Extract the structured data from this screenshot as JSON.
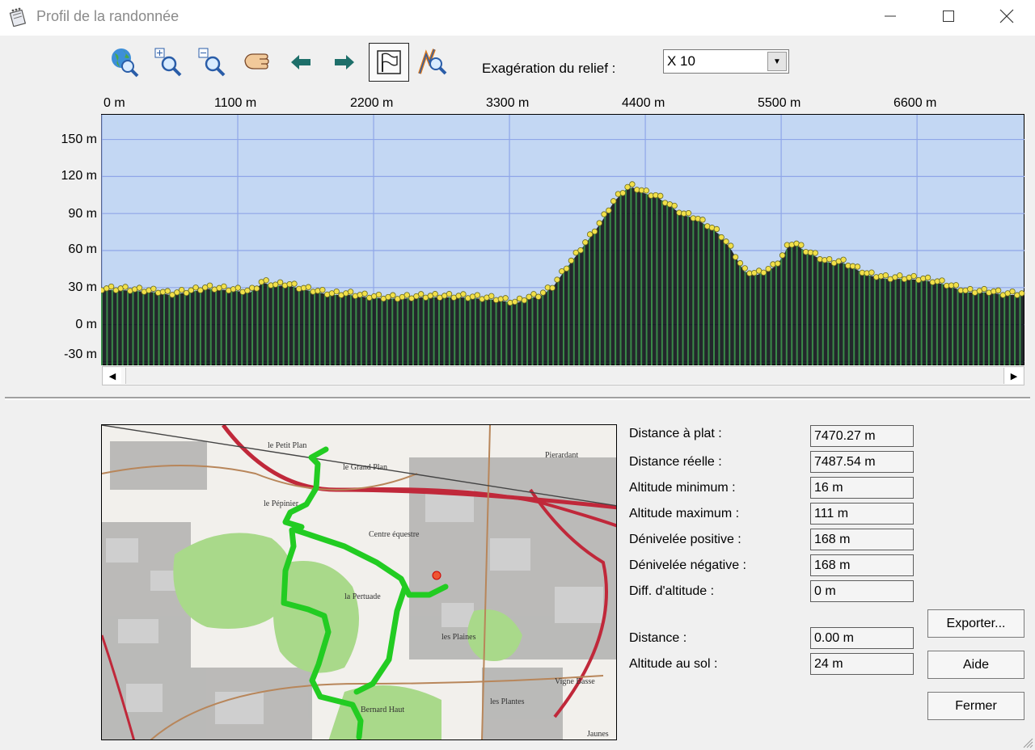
{
  "window": {
    "title": "Profil de la randonnée",
    "minimize_icon": "minimize-icon",
    "maximize_icon": "maximize-icon",
    "close_icon": "close-icon"
  },
  "toolbar": {
    "buttons": [
      {
        "name": "zoom-full-button",
        "icon": "globe-magnifier-icon"
      },
      {
        "name": "zoom-in-button",
        "icon": "zoom-in-icon"
      },
      {
        "name": "zoom-out-button",
        "icon": "zoom-out-icon"
      },
      {
        "name": "pan-button",
        "icon": "hand-icon"
      },
      {
        "name": "previous-button",
        "icon": "arrow-left-icon"
      },
      {
        "name": "next-button",
        "icon": "arrow-right-icon"
      },
      {
        "name": "flag-button",
        "icon": "flag-icon",
        "active": true
      },
      {
        "name": "zoom-profile-button",
        "icon": "profile-zoom-icon"
      }
    ],
    "relief_label": "Exagération du relief :",
    "relief_value": "X 10"
  },
  "chart_data": {
    "type": "area",
    "x_ticks": [
      "0 m",
      "1100 m",
      "2200 m",
      "3300 m",
      "4400 m",
      "5500 m",
      "6600 m"
    ],
    "y_ticks": [
      "150 m",
      "120 m",
      "90 m",
      "60 m",
      "30 m",
      "0 m",
      "-30 m"
    ],
    "x_range": [
      0,
      7470
    ],
    "y_range": [
      -33,
      170
    ],
    "profile": {
      "x": [
        0,
        150,
        300,
        450,
        550,
        700,
        850,
        1000,
        1100,
        1200,
        1250,
        1300,
        1400,
        1500,
        1600,
        1700,
        1850,
        2000,
        2150,
        2300,
        2450,
        2600,
        2750,
        2900,
        3050,
        3200,
        3300,
        3350,
        3450,
        3550,
        3650,
        3750,
        3850,
        3950,
        4050,
        4150,
        4250,
        4300,
        4400,
        4500,
        4600,
        4700,
        4800,
        4900,
        5000,
        5100,
        5200,
        5300,
        5400,
        5450,
        5500,
        5550,
        5600,
        5700,
        5800,
        5850,
        5900,
        6000,
        6100,
        6200,
        6350,
        6500,
        6650,
        6800,
        6950,
        7000,
        7100,
        7200,
        7300,
        7470
      ],
      "y": [
        28,
        28,
        27,
        26,
        24,
        26,
        29,
        28,
        27,
        26,
        29,
        34,
        31,
        32,
        29,
        27,
        24,
        24,
        22,
        21,
        21,
        22,
        22,
        22,
        21,
        20,
        18,
        17,
        21,
        23,
        30,
        44,
        57,
        70,
        84,
        100,
        110,
        111,
        106,
        103,
        96,
        89,
        86,
        80,
        73,
        60,
        43,
        40,
        44,
        47,
        53,
        62,
        66,
        59,
        54,
        51,
        50,
        50,
        45,
        40,
        37,
        37,
        36,
        33,
        28,
        26,
        26,
        26,
        24,
        24
      ]
    },
    "grid": true,
    "background": "#c3d7f3",
    "fill_color": "#000000",
    "bar_color": "#3a8a48",
    "marker_color": "#f2e04a"
  },
  "stats": [
    {
      "label": "Distance à plat :",
      "value": "7470.27 m"
    },
    {
      "label": "Distance réelle :",
      "value": "7487.54 m"
    },
    {
      "label": "Altitude minimum :",
      "value": "16 m"
    },
    {
      "label": "Altitude maximum :",
      "value": "111 m"
    },
    {
      "label": "Dénivelée positive :",
      "value": "168 m"
    },
    {
      "label": "Dénivelée négative :",
      "value": "168 m"
    },
    {
      "label": "Diff. d'altitude :",
      "value": "0 m"
    },
    {
      "label": "Distance :",
      "value": "0.00 m"
    },
    {
      "label": "Altitude au sol :",
      "value": "24 m"
    }
  ],
  "buttons": {
    "export": "Exporter...",
    "help": "Aide",
    "close": "Fermer"
  },
  "map": {
    "labels": [
      "le Petit Plan",
      "le Grand Plan",
      "Pierardant",
      "le Pépinier",
      "Centre équestre",
      "les Plaines",
      "la Pertuade",
      "Bernard Haut",
      "Vigne Basse",
      "les Plantes",
      "Jaunes"
    ],
    "track_color": "#22cc22",
    "road_color": "#c0283a"
  }
}
